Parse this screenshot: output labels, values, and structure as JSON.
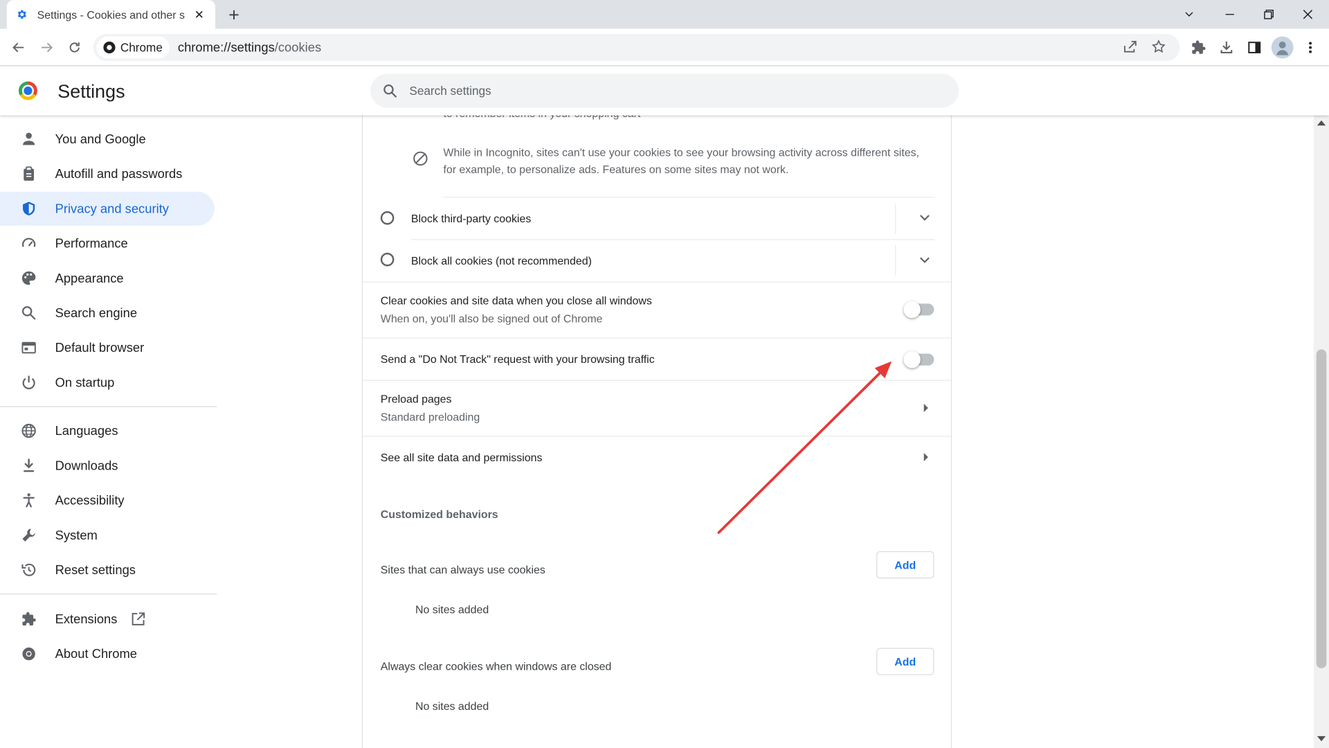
{
  "browser": {
    "tab_title": "Settings - Cookies and other site",
    "omnibox_chip": "Chrome",
    "url_host": "chrome://settings",
    "url_path": "/cookies"
  },
  "header": {
    "title": "Settings",
    "search_placeholder": "Search settings"
  },
  "sidebar": {
    "items": [
      {
        "label": "You and Google",
        "icon": "person-icon"
      },
      {
        "label": "Autofill and passwords",
        "icon": "clipboard-icon"
      },
      {
        "label": "Privacy and security",
        "icon": "shield-icon",
        "active": true
      },
      {
        "label": "Performance",
        "icon": "speedometer-icon"
      },
      {
        "label": "Appearance",
        "icon": "palette-icon"
      },
      {
        "label": "Search engine",
        "icon": "search-icon"
      },
      {
        "label": "Default browser",
        "icon": "browser-icon"
      },
      {
        "label": "On startup",
        "icon": "power-icon"
      },
      {
        "label": "Languages",
        "icon": "globe-icon"
      },
      {
        "label": "Downloads",
        "icon": "download-icon"
      },
      {
        "label": "Accessibility",
        "icon": "accessibility-icon"
      },
      {
        "label": "System",
        "icon": "wrench-icon"
      },
      {
        "label": "Reset settings",
        "icon": "history-icon"
      },
      {
        "label": "Extensions",
        "icon": "puzzle-icon"
      },
      {
        "label": "About Chrome",
        "icon": "chrome-icon"
      }
    ]
  },
  "main": {
    "cut_text": "to remember items in your shopping cart",
    "incognito_note": "While in Incognito, sites can't use your cookies to see your browsing activity across different sites,",
    "incognito_note_2": "for example, to personalize ads. Features on some sites may not work.",
    "block_third_party": "Block third-party cookies",
    "block_all": "Block all cookies (not recommended)",
    "clear_on_close_title": "Clear cookies and site data when you close all windows",
    "clear_on_close_sub": "When on, you'll also be signed out of Chrome",
    "clear_on_close_on": false,
    "dnt_title": "Send a \"Do Not Track\" request with your browsing traffic",
    "dnt_on": false,
    "preload_title": "Preload pages",
    "preload_sub": "Standard preloading",
    "see_all": "See all site data and permissions",
    "customized_header": "Customized behaviors",
    "always_use_title": "Sites that can always use cookies",
    "always_use_empty": "No sites added",
    "always_clear_title": "Always clear cookies when windows are closed",
    "always_clear_empty": "No sites added",
    "add_label": "Add"
  },
  "colors": {
    "accent": "#1a73e8",
    "active_bg": "#e8f0fe",
    "annotation_arrow": "#e53935"
  }
}
